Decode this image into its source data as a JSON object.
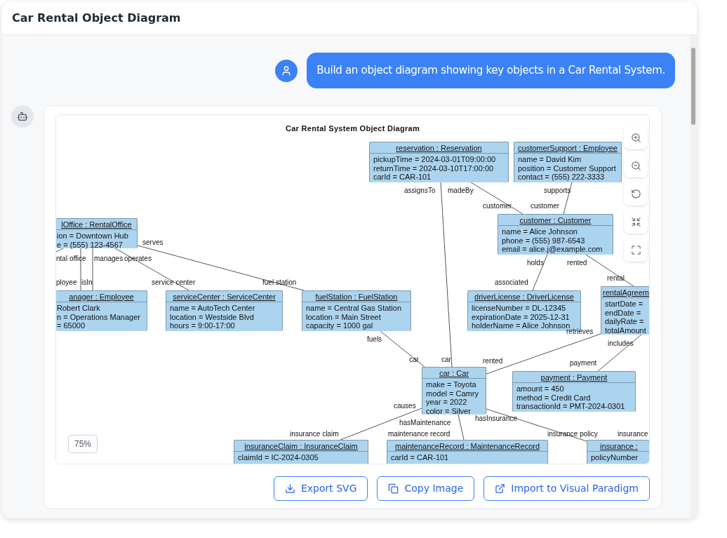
{
  "window": {
    "title": "Car Rental Object Diagram"
  },
  "user_message": {
    "text": "Build an object diagram showing key objects in a Car Rental System."
  },
  "diagram": {
    "title": "Car Rental System Object Diagram",
    "nodes": [
      {
        "header": "lOffice : RentalOffice",
        "attributes": [
          "ion = Downtown Hub",
          "e = (555) 123-4567"
        ]
      },
      {
        "header": "anager : Employee",
        "attributes": [
          "Robert Clark",
          "n = Operations Manager",
          "= 65000"
        ]
      },
      {
        "header": "serviceCenter : ServiceCenter",
        "attributes": [
          "name = AutoTech Center",
          "location = Westside Blvd",
          "hours = 9:00-17:00"
        ]
      },
      {
        "header": "fuelStation : FuelStation",
        "attributes": [
          "name = Central Gas Station",
          "location = Main Street",
          "capacity = 1000 gal"
        ]
      },
      {
        "header": "reservation : Reservation",
        "attributes": [
          "pickupTime = 2024-03-01T09:00:00",
          "returnTime = 2024-03-10T17:00:00",
          "carId = CAR-101"
        ]
      },
      {
        "header": "customerSupport : Employee",
        "attributes": [
          "name = David Kim",
          "position = Customer Support",
          "contact = (555) 222-3333"
        ]
      },
      {
        "header": "customer : Customer",
        "attributes": [
          "name = Alice Johnson",
          "phone = (555) 987-6543",
          "email = alice.j@example.com"
        ]
      },
      {
        "header": "driverLicense : DriverLicense",
        "attributes": [
          "licenseNumber = DL-12345",
          "expirationDate = 2025-12-31",
          "holderName = Alice Johnson"
        ]
      },
      {
        "header": "rentalAgreem",
        "attributes": [
          "startDate =",
          "endDate =",
          "dailyRate =",
          "totalAmount"
        ]
      },
      {
        "header": "car : Car",
        "attributes": [
          "make = Toyota",
          "model = Camry",
          "year = 2022",
          "color = Silver"
        ]
      },
      {
        "header": "payment : Payment",
        "attributes": [
          "amount = 450",
          "method = Credit Card",
          "transactionId = PMT-2024-0301"
        ]
      },
      {
        "header": "insuranceClaim : InsuranceClaim",
        "attributes": [
          "claimId = IC-2024-0305"
        ]
      },
      {
        "header": "maintenanceRecord : MaintenanceRecord",
        "attributes": [
          "carId = CAR-101"
        ]
      },
      {
        "header": "insurance :",
        "attributes": [
          "policyNumber"
        ]
      }
    ],
    "edge_labels": [
      "ntal office",
      "manages",
      "operates",
      "ployee",
      "isIn",
      "service center",
      "serves",
      "fuel station",
      "assignsTo",
      "madeBy",
      "customer",
      "supports",
      "customer",
      "holds",
      "rented",
      "associated",
      "rental",
      "fuels",
      "car",
      "car",
      "retrieves",
      "includes",
      "rented",
      "payment",
      "causes",
      "hasMaintenance",
      "hasInsurance",
      "insurance claim",
      "maintenance record",
      "insurance policy",
      "insurance"
    ],
    "zoom_level": "75%"
  },
  "actions": [
    "Export SVG",
    "Copy Image",
    "Import to Visual Paradigm"
  ]
}
